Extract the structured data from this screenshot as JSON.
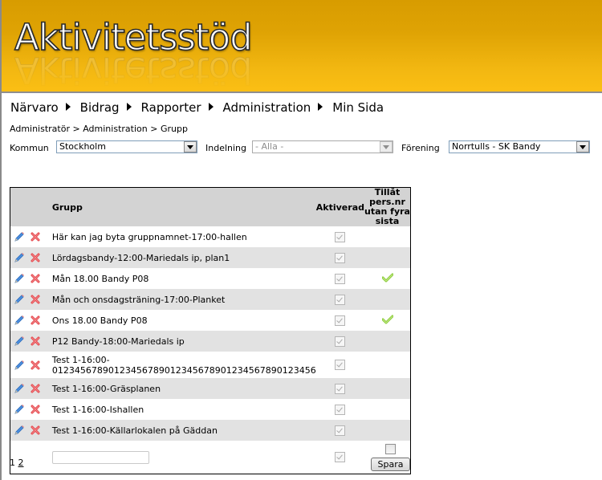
{
  "app": {
    "logo_text": "Aktivitetsstöd"
  },
  "colors": {
    "header_top": "#d89c00",
    "header_bottom": "#fbbf14",
    "table_header_bg": "#d3d3d3",
    "alt_row_bg": "#e2e2e2",
    "edit_icon": "#3b7fd4",
    "delete_icon": "#e0393e",
    "green_check": "#8ccf3c"
  },
  "nav": {
    "items": [
      {
        "label": "Närvaro"
      },
      {
        "label": "Bidrag"
      },
      {
        "label": "Rapporter"
      },
      {
        "label": "Administration"
      },
      {
        "label": "Min Sida"
      }
    ]
  },
  "breadcrumb": {
    "items": [
      "Administratör",
      "Administration",
      "Grupp"
    ],
    "separator": ">"
  },
  "filters": {
    "kommun": {
      "label": "Kommun",
      "value": "Stockholm"
    },
    "indelning": {
      "label": "Indelning",
      "value": "- Alla -",
      "disabled": true
    },
    "forening": {
      "label": "Förening",
      "value": "Norrtulls - SK Bandy"
    }
  },
  "table": {
    "headers": {
      "actions": "",
      "name": "Grupp",
      "activated": "Aktiverad",
      "allow_line1": "Tillåt pers.nr",
      "allow_line2": "utan fyra sista"
    },
    "rows": [
      {
        "name": "Här kan jag byta gruppnamnet-17:00-hallen",
        "activated": true,
        "allow": false
      },
      {
        "name": "Lördagsbandy-12:00-Mariedals ip, plan1",
        "activated": true,
        "allow": false
      },
      {
        "name": "Mån 18.00 Bandy P08",
        "activated": true,
        "allow": true
      },
      {
        "name": "Mån och onsdagsträning-17:00-Planket",
        "activated": true,
        "allow": false
      },
      {
        "name": "Ons 18.00 Bandy P08",
        "activated": true,
        "allow": true
      },
      {
        "name": "P12 Bandy-18:00-Mariedals ip",
        "activated": true,
        "allow": false
      },
      {
        "name_line1": "Test 1-16:00-",
        "name_line2": "01234567890123456789012345678901234567890123456",
        "name": "Test 1-16:00-0123456789012345678901234567890123456",
        "activated": true,
        "allow": false
      },
      {
        "name": "Test 1-16:00-Gräsplanen",
        "activated": true,
        "allow": false
      },
      {
        "name": "Test 1-16:00-Ishallen",
        "activated": true,
        "allow": false
      },
      {
        "name": "Test 1-16:00-Källarlokalen på Gäddan",
        "activated": true,
        "allow": false
      }
    ],
    "new_row": {
      "name_value": "",
      "activated": true,
      "allow": false,
      "save_label": "Spara"
    }
  },
  "pager": {
    "current": "1",
    "pages": [
      "1",
      "2"
    ]
  }
}
